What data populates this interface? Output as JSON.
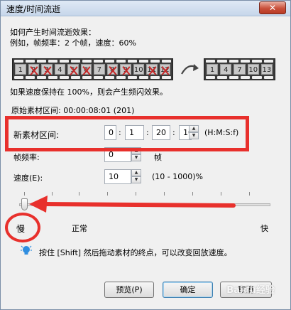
{
  "window": {
    "title": "速度/时间流逝",
    "close_glyph": "✕"
  },
  "intro": {
    "line1": "如何产生时间流逝效果：",
    "line2": "例如，帧频率：2 个帧，速度：60%"
  },
  "film_left": {
    "frames": [
      {
        "label": "1",
        "crossed": false
      },
      {
        "label": "2",
        "crossed": true
      },
      {
        "label": "3",
        "crossed": true
      },
      {
        "label": "4",
        "crossed": false
      },
      {
        "label": "5",
        "crossed": true
      },
      {
        "label": "6",
        "crossed": true
      },
      {
        "label": "7",
        "crossed": false
      },
      {
        "label": "8",
        "crossed": true
      },
      {
        "label": "9",
        "crossed": true
      },
      {
        "label": "10",
        "crossed": false
      },
      {
        "label": "11",
        "crossed": true
      },
      {
        "label": "12",
        "crossed": true
      }
    ]
  },
  "film_right": {
    "frames": [
      "1",
      "4",
      "7",
      "10",
      "13"
    ]
  },
  "notes": {
    "strobe": "如果速度保持在 100%，则会产生频闪效果。",
    "original_range": "原始素材区间: 00:00:08:01 (201)"
  },
  "new_duration": {
    "label": "新素材区间:",
    "hours": "0",
    "minutes": "1",
    "seconds": "20",
    "frames": "10",
    "format": "(H:M:S:f)"
  },
  "frame_rate": {
    "label": "帧频率:",
    "value": "0",
    "unit": "帧"
  },
  "speed": {
    "label": "速度(E):",
    "value": "10",
    "range": "(10 - 1000)%"
  },
  "slider": {
    "slow": "慢",
    "normal": "正常",
    "fast": "快"
  },
  "hint": "按住 [Shift] 然后拖动素材的终点，可以改变回放速度。",
  "buttons": {
    "preview": "预览(P)",
    "ok": "确定",
    "cancel": "取消"
  },
  "watermark": "Baidu经验",
  "colors": {
    "annotation_red": "#e8302c",
    "bulb_blue": "#2f8ee0"
  }
}
